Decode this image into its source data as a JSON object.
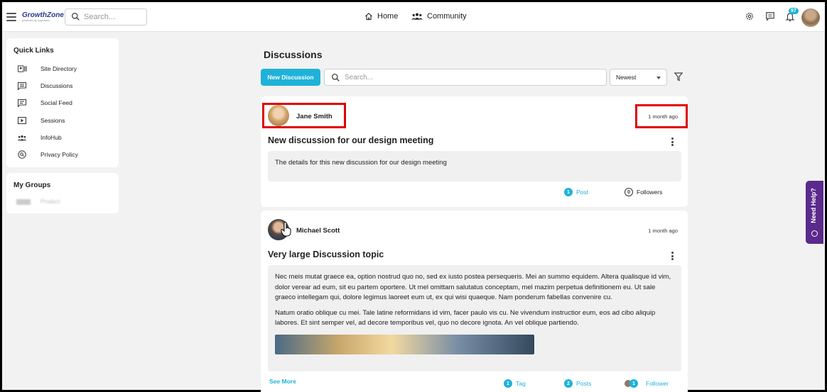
{
  "header": {
    "logo_text": "GrowthZone",
    "logo_tagline": "powered by Lognomic",
    "search_placeholder": "Search...",
    "nav": [
      {
        "label": "Home",
        "icon": "home-icon"
      },
      {
        "label": "Community",
        "icon": "community-icon"
      }
    ],
    "notification_count": "97",
    "icons": [
      "gear-icon",
      "chat-icon",
      "bell-icon"
    ]
  },
  "sidebar": {
    "quick_links_title": "Quick Links",
    "items": [
      {
        "label": "Site Directory",
        "icon": "directory-icon"
      },
      {
        "label": "Discussions",
        "icon": "discussion-icon"
      },
      {
        "label": "Social Feed",
        "icon": "social-feed-icon"
      },
      {
        "label": "Sessions",
        "icon": "play-icon"
      },
      {
        "label": "InfoHub",
        "icon": "people-icon"
      },
      {
        "label": "Privacy Policy",
        "icon": "privacy-icon"
      }
    ],
    "my_groups_title": "My Groups",
    "groups": [
      {
        "label": "Product"
      }
    ]
  },
  "main": {
    "title": "Discussions",
    "new_button": "New Discussion",
    "search_placeholder": "Search...",
    "sort_selected": "Newest",
    "posts": [
      {
        "author": "Jane Smith",
        "time": "1 month ago",
        "title": "New discussion for our design meeting",
        "body": [
          "The details for this new discussion for our design meeting"
        ],
        "meta": [
          {
            "count": "1",
            "label": "Post",
            "style": "filled"
          },
          {
            "count": "0",
            "label": "Followers",
            "style": "outline"
          }
        ]
      },
      {
        "author": "Michael Scott",
        "time": "1 month ago",
        "title": "Very large Discussion topic",
        "body": [
          "Nec meis mutat graece ea, option nostrud quo no, sed ex iusto postea persequeris. Mei an summo equidem. Altera qualisque id vim, dolor verear ad eum, sit eu partem oportere. Ut mel omittam salutatus conceptam, mel mazim perpetua definitionem eu. Ut sale graeco intellegam qui, dolore legimus laoreet eum ut, ex qui wisi quaeque. Nam ponderum fabellas convenire cu.",
          "Natum oratio oblique cu mei. Tale latine reformidans id vim, facer paulo vis cu. Ne vivendum instructior eum, eos ad cibo aliquip labores. Et sint semper vel, ad decore temporibus vel, quo no decore ignota. An vel oblique partiendo."
        ],
        "see_more": "See More",
        "meta": [
          {
            "count": "1",
            "label": "Tag",
            "style": "filled"
          },
          {
            "count": "2",
            "label": "Posts",
            "style": "filled"
          },
          {
            "count": "1",
            "label": "Follower",
            "style": "filled"
          }
        ]
      }
    ]
  },
  "help_tab": {
    "label": "Need Help?"
  },
  "colors": {
    "accent": "#1fb2d8",
    "help_tab": "#5b2a8c",
    "highlight": "#e00000"
  }
}
